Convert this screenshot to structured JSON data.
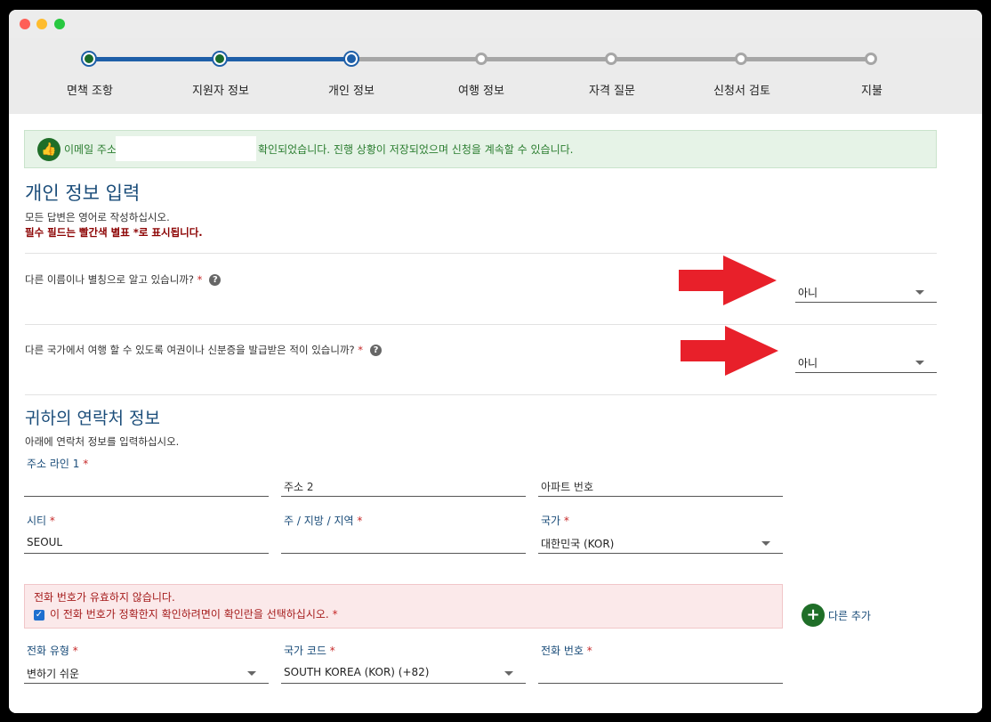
{
  "steps": [
    {
      "label": "면책 조항",
      "state": "complete"
    },
    {
      "label": "지원자 정보",
      "state": "complete"
    },
    {
      "label": "개인 정보",
      "state": "current"
    },
    {
      "label": "여행 정보",
      "state": "pending"
    },
    {
      "label": "자격 질문",
      "state": "pending"
    },
    {
      "label": "신청서 검토",
      "state": "pending"
    },
    {
      "label": "지불",
      "state": "pending"
    }
  ],
  "alert": {
    "prefix": "이메일 주소",
    "message": "확인되었습니다. 진행 상황이 저장되었으며 신청을 계속할 수 있습니다."
  },
  "personal": {
    "title": "개인 정보 입력",
    "english_note": "모든 답변은 영어로 작성하십시오.",
    "required_note": "필수 필드는 빨간색 별표 *로 표시됩니다.",
    "q1": {
      "text": "다른 이름이나 별칭으로 알고 있습니까?",
      "value": "아니"
    },
    "q2": {
      "text": "다른 국가에서 여행 할 수 있도록 여권이나 신분증을 발급받은 적이 있습니까?",
      "value": "아니"
    }
  },
  "contact": {
    "title": "귀하의 연락처 정보",
    "subtitle": "아래에 연락처 정보를 입력하십시오.",
    "address1_label": "주소 라인 1",
    "address1_value": "",
    "address2_placeholder": "주소 2",
    "apt_placeholder": "아파트 번호",
    "city_label": "시티",
    "city_value": "SEOUL",
    "state_label": "주 / 지방 / 지역",
    "state_value": "",
    "country_label": "국가",
    "country_value": "대한민국 (KOR)"
  },
  "phone": {
    "error_title": "전화 번호가 유효하지 않습니다.",
    "confirm_text": "이 전화 번호가 정확한지 확인하려면이 확인란을 선택하십시오.",
    "add_more": "다른 추가",
    "type_label": "전화 유형",
    "type_value": "변하기 쉬운",
    "code_label": "국가 코드",
    "code_value": "SOUTH KOREA (KOR) (+82)",
    "number_label": "전화 번호",
    "number_value": ""
  },
  "colors": {
    "progress_done": "#1e5fa8",
    "progress_pending": "#a6a6a6",
    "step_complete": "#196a2b",
    "heading": "#1b4d7a",
    "required": "#c62828",
    "arrow": "#e8202a"
  }
}
